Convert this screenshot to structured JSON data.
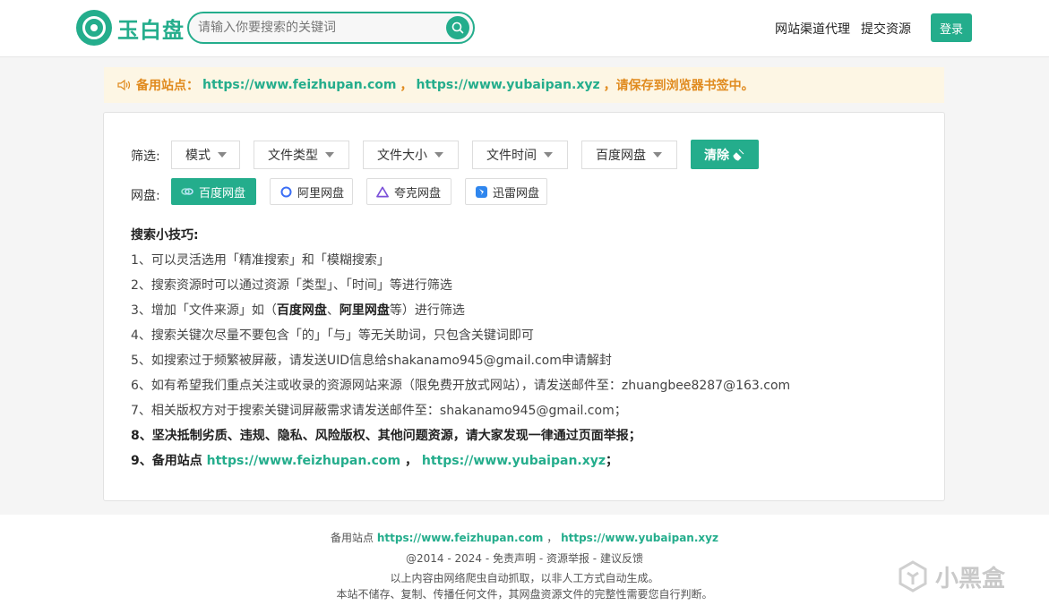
{
  "header": {
    "logo_text": "玉白盘",
    "search_placeholder": "请输入你要搜索的关键词",
    "nav": [
      "网站渠道代理",
      "提交资源"
    ],
    "login_label": "登录"
  },
  "notice": {
    "prefix": "备用站点：",
    "link1": "https://www.feizhupan.com",
    "sep": "，",
    "link2": "https://www.yubaipan.xyz",
    "suffix": "，请保存到浏览器书签中。"
  },
  "filters": {
    "label": "筛选:",
    "dropdowns": [
      "模式",
      "文件类型",
      "文件大小",
      "文件时间",
      "百度网盘"
    ],
    "clear_label": "清除"
  },
  "pans": {
    "label": "网盘:",
    "items": [
      "百度网盘",
      "阿里网盘",
      "夸克网盘",
      "迅雷网盘"
    ]
  },
  "tips": {
    "title": "搜索小技巧:",
    "l1": "1、可以灵活选用「精准搜索」和「模糊搜索」",
    "l2": "2、搜索资源时可以通过资源「类型」、「时间」等进行筛选",
    "l3_a": "3、增加「文件来源」如（",
    "l3_b": "百度网盘",
    "l3_c": "、",
    "l3_d": "阿里网盘",
    "l3_e": "等）进行筛选",
    "l4": "4、搜索关键次尽量不要包含「的」「与」等无关助词，只包含关键词即可",
    "l5": "5、如搜索过于频繁被屏蔽，请发送UID信息给shakanamo945@gmail.com申请解封",
    "l6": "6、如有希望我们重点关注或收录的资源网站来源（限免费开放式网站），请发送邮件至：zhuangbee8287@163.com",
    "l7": "7、相关版权方对于搜索关键词屏蔽需求请发送邮件至：shakanamo945@gmail.com；",
    "l8": "8、坚决抵制劣质、违规、隐私、风险版权、其他问题资源，请大家发现一律通过页面举报；",
    "l9_a": "9、备用站点 ",
    "l9_link1": "https://www.feizhupan.com",
    "l9_sep": " ， ",
    "l9_link2": "https://www.yubaipan.xyz",
    "l9_end": "；"
  },
  "footer": {
    "f1_prefix": "备用站点 ",
    "f1_link1": "https://www.feizhupan.com",
    "f1_sep": " ， ",
    "f1_link2": "https://www.yubaipan.xyz",
    "f2": "@2014 - 2024 - 免责声明 - 资源举报 - 建议反馈",
    "f3": "以上内容由网络爬虫自动抓取，以非人工方式自动生成。",
    "f4": "本站不储存、复制、传播任何文件，其网盘资源文件的完整性需要您自行判断。"
  },
  "watermark": "小黑盒",
  "colors": {
    "accent": "#24ad8c",
    "notice_text": "#e08a1e",
    "notice_bg": "#fdf6e4"
  }
}
